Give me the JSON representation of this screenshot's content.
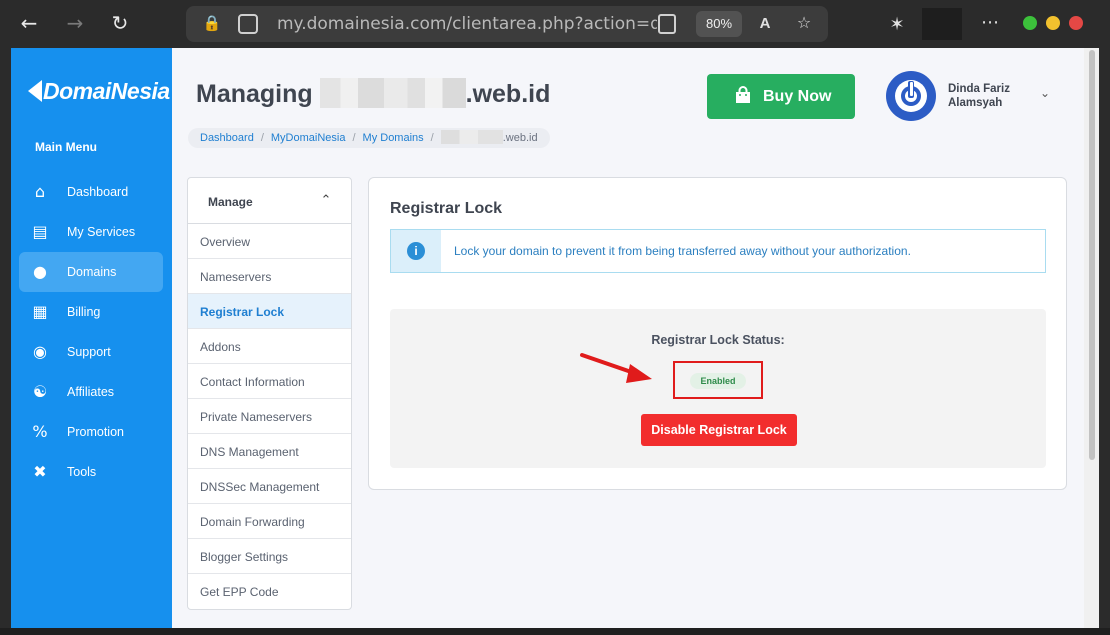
{
  "browser": {
    "url": "my.domainesia.com/clientarea.php?action=domaindetails",
    "zoom": "80%",
    "traffic_colors": {
      "min": "#3cc13b",
      "max": "#f2c12e",
      "close": "#e44845"
    }
  },
  "sidebar": {
    "logo": "DomaiNesia",
    "main_menu_label": "Main Menu",
    "items": [
      {
        "label": "Dashboard",
        "icon": "home-icon"
      },
      {
        "label": "My Services",
        "icon": "server-icon"
      },
      {
        "label": "Domains",
        "icon": "globe-icon",
        "active": true
      },
      {
        "label": "Billing",
        "icon": "receipt-icon"
      },
      {
        "label": "Support",
        "icon": "headset-icon"
      },
      {
        "label": "Affiliates",
        "icon": "users-icon"
      },
      {
        "label": "Promotion",
        "icon": "percent-icon"
      },
      {
        "label": "Tools",
        "icon": "tools-icon"
      }
    ]
  },
  "header": {
    "title_prefix": "Managing",
    "title_suffix": ".web.id",
    "buy_button": "Buy Now",
    "user_name": "Dinda Fariz Alamsyah"
  },
  "breadcrumb": {
    "items": [
      "Dashboard",
      "MyDomaiNesia",
      "My Domains"
    ],
    "current_suffix": ".web.id"
  },
  "manage": {
    "title": "Manage",
    "items": [
      {
        "label": "Overview"
      },
      {
        "label": "Nameservers"
      },
      {
        "label": "Registrar Lock",
        "active": true
      },
      {
        "label": "Addons"
      },
      {
        "label": "Contact Information"
      },
      {
        "label": "Private Nameservers"
      },
      {
        "label": "DNS Management"
      },
      {
        "label": "DNSSec Management"
      },
      {
        "label": "Domain Forwarding"
      },
      {
        "label": "Blogger Settings"
      },
      {
        "label": "Get EPP Code"
      }
    ]
  },
  "registrar_lock": {
    "title": "Registrar Lock",
    "info": "Lock your domain to prevent it from being transferred away without your authorization.",
    "status_label": "Registrar Lock Status:",
    "status_value": "Enabled",
    "disable_button": "Disable Registrar Lock"
  },
  "colors": {
    "sidebar": "#1690ee",
    "buy": "#27ae60",
    "danger": "#f22d2d",
    "annotation": "#e01b1b"
  }
}
